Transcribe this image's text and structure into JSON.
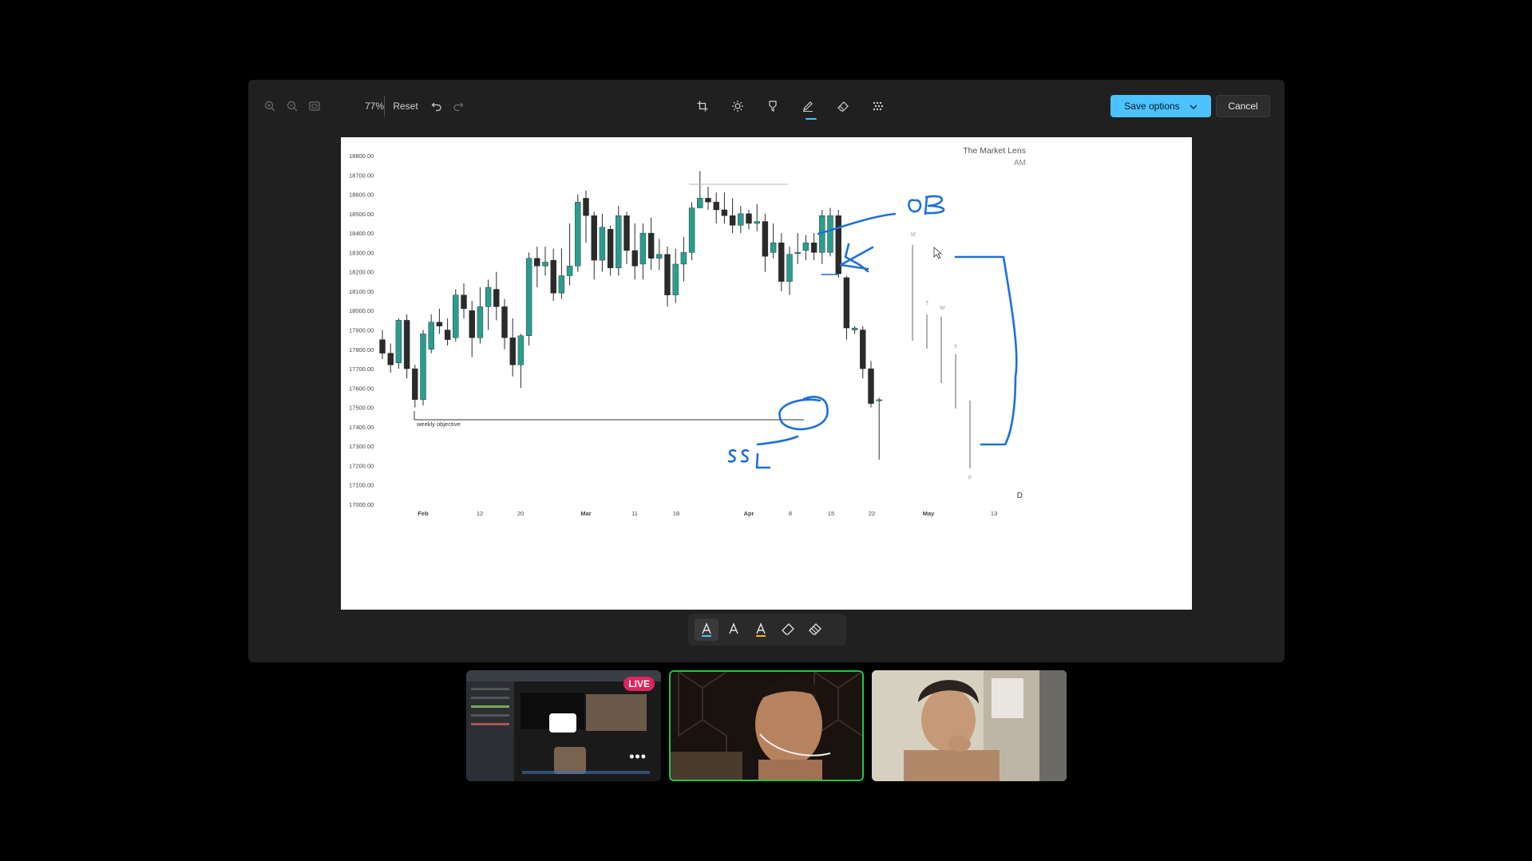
{
  "toolbar": {
    "zoom_in_icon": "zoom-in-icon",
    "zoom_out_icon": "zoom-out-icon",
    "fit_icon": "fit-to-window-icon",
    "zoom_level": "77%",
    "reset_label": "Reset",
    "undo_icon": "undo-icon",
    "redo_icon": "redo-icon",
    "tools": [
      "crop-icon",
      "brightness-icon",
      "markup-icon",
      "draw-icon",
      "erase-background-icon",
      "blur-icon"
    ],
    "save_label": "Save options",
    "cancel_label": "Cancel"
  },
  "chart_overlay": {
    "brand": "The Market Lens",
    "brand_sub": "AM",
    "period": "D",
    "weekly_label": "weekly objective",
    "handwritten": [
      "OB",
      "SSL"
    ],
    "session_letters": [
      "M",
      "T",
      "W",
      "T",
      "F"
    ]
  },
  "chart_data": {
    "type": "candlestick",
    "y_ticks": [
      "18800.00",
      "18700.00",
      "18600.00",
      "18500.00",
      "18400.00",
      "18300.00",
      "18200.00",
      "18100.00",
      "18000.00",
      "17900.00",
      "17800.00",
      "17700.00",
      "17600.00",
      "17500.00",
      "17400.00",
      "17300.00",
      "17200.00",
      "17100.00",
      "17000.00"
    ],
    "x_ticks": [
      "Feb",
      "12",
      "20",
      "Mar",
      "11",
      "18",
      "Apr",
      "8",
      "15",
      "22",
      "May",
      "13"
    ],
    "ylim": [
      17000,
      18800
    ],
    "candles": [
      [
        17850,
        17780,
        17900,
        17750
      ],
      [
        17780,
        17720,
        17830,
        17680
      ],
      [
        17730,
        17950,
        17960,
        17700
      ],
      [
        17950,
        17700,
        17980,
        17650
      ],
      [
        17700,
        17540,
        17720,
        17500
      ],
      [
        17540,
        17880,
        17900,
        17510
      ],
      [
        17800,
        17940,
        17980,
        17780
      ],
      [
        17940,
        17920,
        18010,
        17880
      ],
      [
        17900,
        17850,
        17960,
        17820
      ],
      [
        17860,
        18080,
        18110,
        17840
      ],
      [
        18080,
        18010,
        18140,
        17960
      ],
      [
        18000,
        17860,
        18050,
        17760
      ],
      [
        17860,
        18020,
        18120,
        17830
      ],
      [
        18020,
        18120,
        18160,
        17900
      ],
      [
        18110,
        18020,
        18200,
        17950
      ],
      [
        18020,
        17860,
        18060,
        17800
      ],
      [
        17860,
        17720,
        17960,
        17660
      ],
      [
        17720,
        17870,
        17880,
        17600
      ],
      [
        17870,
        18270,
        18300,
        17820
      ],
      [
        18270,
        18230,
        18330,
        18120
      ],
      [
        18230,
        18250,
        18330,
        18180
      ],
      [
        18260,
        18090,
        18320,
        18050
      ],
      [
        18090,
        18180,
        18320,
        18060
      ],
      [
        18180,
        18230,
        18450,
        18130
      ],
      [
        18230,
        18560,
        18600,
        18200
      ],
      [
        18580,
        18490,
        18620,
        18350
      ],
      [
        18490,
        18260,
        18510,
        18160
      ],
      [
        18260,
        18430,
        18500,
        18200
      ],
      [
        18420,
        18220,
        18440,
        18180
      ],
      [
        18220,
        18490,
        18540,
        18180
      ],
      [
        18490,
        18310,
        18510,
        18240
      ],
      [
        18310,
        18230,
        18450,
        18160
      ],
      [
        18240,
        18400,
        18450,
        18160
      ],
      [
        18400,
        18270,
        18480,
        18210
      ],
      [
        18270,
        18290,
        18370,
        18210
      ],
      [
        18290,
        18080,
        18330,
        18020
      ],
      [
        18080,
        18240,
        18320,
        18040
      ],
      [
        18240,
        18300,
        18380,
        18150
      ],
      [
        18300,
        18530,
        18560,
        18260
      ],
      [
        18530,
        18580,
        18720,
        18540
      ],
      [
        18580,
        18560,
        18640,
        18520
      ],
      [
        18560,
        18520,
        18610,
        18450
      ],
      [
        18520,
        18490,
        18610,
        18450
      ],
      [
        18490,
        18440,
        18580,
        18400
      ],
      [
        18440,
        18500,
        18540,
        18400
      ],
      [
        18500,
        18450,
        18520,
        18420
      ],
      [
        18450,
        18460,
        18550,
        18410
      ],
      [
        18460,
        18280,
        18500,
        18200
      ],
      [
        18300,
        18350,
        18450,
        18270
      ],
      [
        18350,
        18150,
        18400,
        18100
      ],
      [
        18150,
        18290,
        18330,
        18080
      ],
      [
        18300,
        18300,
        18400,
        18240
      ],
      [
        18310,
        18350,
        18390,
        18260
      ],
      [
        18350,
        18300,
        18400,
        18260
      ],
      [
        18300,
        18490,
        18520,
        18240
      ],
      [
        18300,
        18490,
        18530,
        18280
      ],
      [
        18490,
        18190,
        18520,
        18170
      ],
      [
        18170,
        17910,
        18180,
        17850
      ],
      [
        17900,
        17910,
        17920,
        17880
      ],
      [
        17900,
        17700,
        17920,
        17650
      ],
      [
        17700,
        17520,
        17740,
        17500
      ],
      [
        17540,
        17540,
        17550,
        17230
      ]
    ]
  },
  "participants": [
    {
      "role": "screen-share",
      "badge": "LIVE",
      "menu": "•••"
    },
    {
      "role": "speaker"
    },
    {
      "role": "participant"
    }
  ]
}
